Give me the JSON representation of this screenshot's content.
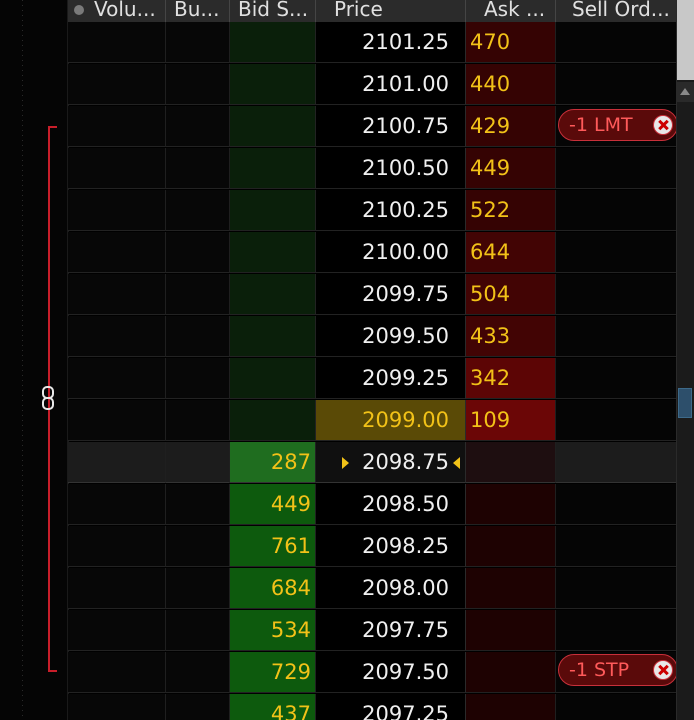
{
  "header": {
    "volume_label": "Volu...",
    "buy_orders_label": "Bu...",
    "bid_size_label": "Bid S...",
    "price_label": "Price",
    "ask_size_label": "Ask ...",
    "sell_orders_label": "Sell Ord..."
  },
  "rows": [
    {
      "price": "2101.25",
      "bid": "",
      "ask": "470"
    },
    {
      "price": "2101.00",
      "bid": "",
      "ask": "440"
    },
    {
      "price": "2100.75",
      "bid": "",
      "ask": "429"
    },
    {
      "price": "2100.50",
      "bid": "",
      "ask": "449"
    },
    {
      "price": "2100.25",
      "bid": "",
      "ask": "522"
    },
    {
      "price": "2100.00",
      "bid": "",
      "ask": "644"
    },
    {
      "price": "2099.75",
      "bid": "",
      "ask": "504"
    },
    {
      "price": "2099.50",
      "bid": "",
      "ask": "433"
    },
    {
      "price": "2099.25",
      "bid": "",
      "ask": "342"
    },
    {
      "price": "2099.00",
      "bid": "",
      "ask": "109"
    },
    {
      "price": "2098.75",
      "bid": "287",
      "ask": ""
    },
    {
      "price": "2098.50",
      "bid": "449",
      "ask": ""
    },
    {
      "price": "2098.25",
      "bid": "761",
      "ask": ""
    },
    {
      "price": "2098.00",
      "bid": "684",
      "ask": ""
    },
    {
      "price": "2097.75",
      "bid": "534",
      "ask": ""
    },
    {
      "price": "2097.50",
      "bid": "729",
      "ask": ""
    },
    {
      "price": "2097.25",
      "bid": "437",
      "ask": ""
    }
  ],
  "orders": [
    {
      "label": "-1 LMT",
      "price": "2100.75"
    },
    {
      "label": "-1 STP",
      "price": "2097.50"
    }
  ],
  "colors": {
    "bid_bg": "#0d5a0d",
    "ask_bg": "#5c0505",
    "size_text": "#f2c218",
    "order_text": "#ff5a5a",
    "bracket": "#c81e2a"
  },
  "icons": {
    "link": "link-icon",
    "cancel": "cancel-order-icon",
    "last_trade_marker": "last-trade-arrow-icon"
  }
}
